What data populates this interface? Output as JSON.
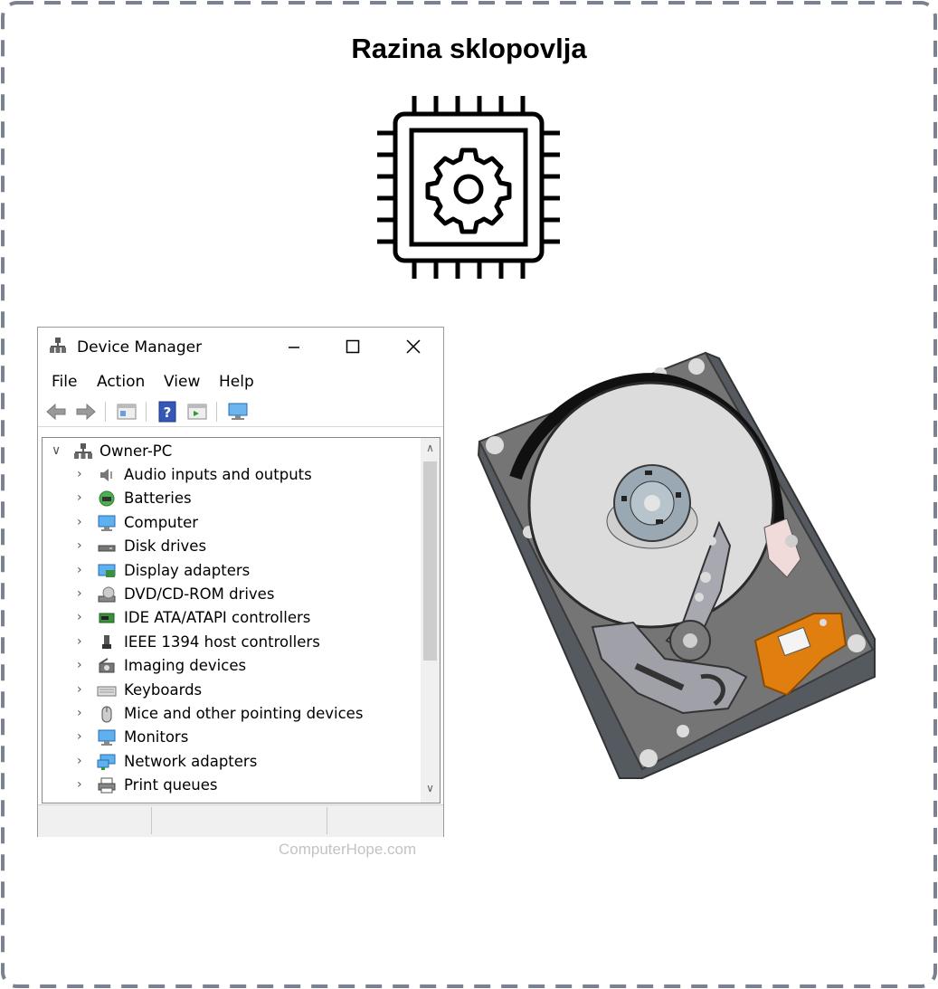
{
  "title": "Razina sklopovlja",
  "chip_icon": "cpu-chip-gear-icon",
  "device_manager": {
    "window_title": "Device Manager",
    "window_controls": [
      "minimize-icon",
      "maximize-icon",
      "close-icon"
    ],
    "menu": [
      "File",
      "Action",
      "View",
      "Help"
    ],
    "toolbar_icons": [
      "back-arrow-icon",
      "forward-arrow-icon",
      "properties-icon",
      "help-icon",
      "update-driver-icon",
      "scan-hardware-icon"
    ],
    "root": "Owner-PC",
    "items": [
      {
        "label": "Audio inputs and outputs",
        "icon": "speaker-icon"
      },
      {
        "label": "Batteries",
        "icon": "battery-icon"
      },
      {
        "label": "Computer",
        "icon": "computer-icon"
      },
      {
        "label": "Disk drives",
        "icon": "disk-drive-icon"
      },
      {
        "label": "Display adapters",
        "icon": "display-adapter-icon"
      },
      {
        "label": "DVD/CD-ROM drives",
        "icon": "dvd-drive-icon"
      },
      {
        "label": "IDE ATA/ATAPI controllers",
        "icon": "ide-controller-icon"
      },
      {
        "label": "IEEE 1394 host controllers",
        "icon": "firewire-icon"
      },
      {
        "label": "Imaging devices",
        "icon": "camera-icon"
      },
      {
        "label": "Keyboards",
        "icon": "keyboard-icon"
      },
      {
        "label": "Mice and other pointing devices",
        "icon": "mouse-icon"
      },
      {
        "label": "Monitors",
        "icon": "monitor-icon"
      },
      {
        "label": "Network adapters",
        "icon": "network-adapter-icon"
      },
      {
        "label": "Print queues",
        "icon": "printer-icon"
      }
    ]
  },
  "watermark": "ComputerHope.com",
  "hdd_image": "hard-disk-drive-icon",
  "colors": {
    "frame_dash": "#7a8190",
    "hdd_platter": "#dcdcdc",
    "hdd_body": "#6e6e6e",
    "hdd_pcb": "#e07f10",
    "icon_blue": "#3c8fd8"
  }
}
